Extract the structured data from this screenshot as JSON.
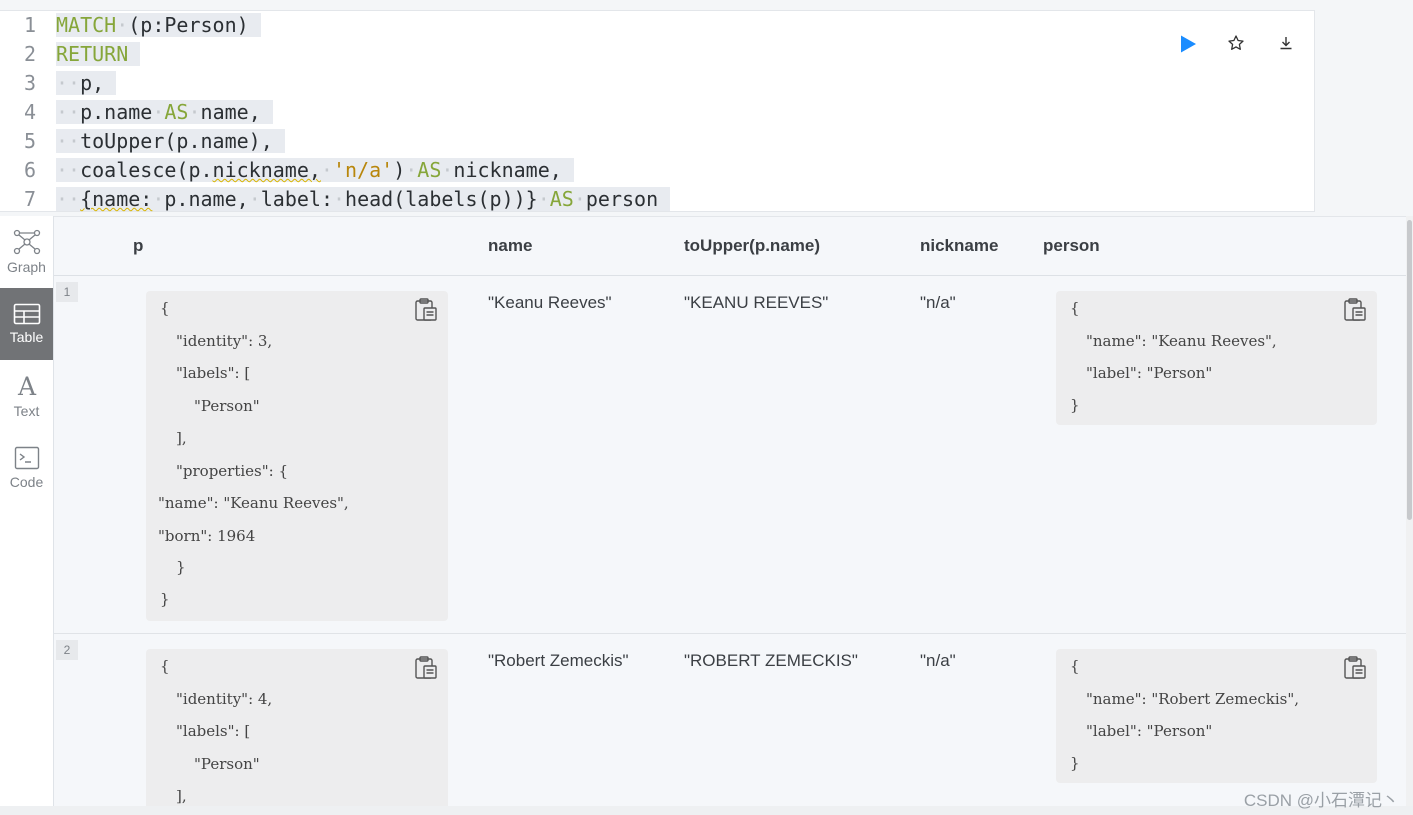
{
  "editor": {
    "line_numbers": [
      "1",
      "2",
      "3",
      "4",
      "5",
      "6",
      "7"
    ],
    "lines": [
      {
        "parts": [
          [
            "kw",
            "MATCH"
          ],
          [
            "dot",
            "·"
          ],
          [
            "txt",
            "(p:Person)"
          ]
        ]
      },
      {
        "parts": [
          [
            "kw",
            "RETURN"
          ]
        ]
      },
      {
        "parts": [
          [
            "dot",
            "··"
          ],
          [
            "txt",
            "p,"
          ]
        ]
      },
      {
        "parts": [
          [
            "dot",
            "··"
          ],
          [
            "txt",
            "p.name"
          ],
          [
            "dot",
            "·"
          ],
          [
            "kw",
            "AS"
          ],
          [
            "dot",
            "·"
          ],
          [
            "txt",
            "name,"
          ]
        ]
      },
      {
        "parts": [
          [
            "dot",
            "··"
          ],
          [
            "txt",
            "toUpper(p.name),"
          ]
        ]
      },
      {
        "parts": [
          [
            "dot",
            "··"
          ],
          [
            "txt",
            "coalesce(p."
          ],
          [
            "sq",
            "nickname,"
          ],
          [
            "dot",
            "·"
          ],
          [
            "str",
            "'n/a'"
          ],
          [
            "txt",
            ")"
          ],
          [
            "dot",
            "·"
          ],
          [
            "kw",
            "AS"
          ],
          [
            "dot",
            "·"
          ],
          [
            "txt",
            "nickname,"
          ]
        ]
      },
      {
        "parts": [
          [
            "dot",
            "··"
          ],
          [
            "sq",
            "{name:"
          ],
          [
            "dot",
            "·"
          ],
          [
            "txt",
            "p.name,"
          ],
          [
            "dot",
            "·"
          ],
          [
            "txt",
            "label:"
          ],
          [
            "dot",
            "·"
          ],
          [
            "txt",
            "head(labels(p))}"
          ],
          [
            "dot",
            "·"
          ],
          [
            "kw",
            "AS"
          ],
          [
            "dot",
            "·"
          ],
          [
            "txt",
            "person"
          ]
        ]
      }
    ],
    "actions": {
      "run": "play-icon",
      "favorite": "star-icon",
      "download": "download-icon"
    },
    "accent": "#1a8cff"
  },
  "sidebar": {
    "items": [
      {
        "label": "Graph",
        "icon": "graph-icon"
      },
      {
        "label": "Table",
        "icon": "table-icon",
        "active": true
      },
      {
        "label": "Text",
        "icon": "text-icon"
      },
      {
        "label": "Code",
        "icon": "code-icon"
      }
    ]
  },
  "table": {
    "columns": [
      "p",
      "name",
      "toUpper(p.name)",
      "nickname",
      "person"
    ],
    "rows": [
      {
        "num": "1",
        "p_json": [
          "{",
          "\"identity\": 3,",
          "\"labels\": [",
          "\"Person\"",
          "],",
          "\"properties\": {",
          "\"name\": \"Keanu Reeves\",",
          "\"born\": 1964",
          "}",
          "}"
        ],
        "name": "\"Keanu Reeves\"",
        "upper": "\"KEANU REEVES\"",
        "nickname": "\"n/a\"",
        "person_json": [
          "{",
          "\"name\": \"Keanu Reeves\",",
          "\"label\": \"Person\"",
          "}"
        ]
      },
      {
        "num": "2",
        "p_json": [
          "{",
          "\"identity\": 4,",
          "\"labels\": [",
          "\"Person\"",
          "],"
        ],
        "name": "\"Robert Zemeckis\"",
        "upper": "\"ROBERT ZEMECKIS\"",
        "nickname": "\"n/a\"",
        "person_json": [
          "{",
          "\"name\": \"Robert Zemeckis\",",
          "\"label\": \"Person\"",
          "}"
        ]
      }
    ]
  },
  "watermark": "CSDN @小石潭记丶"
}
